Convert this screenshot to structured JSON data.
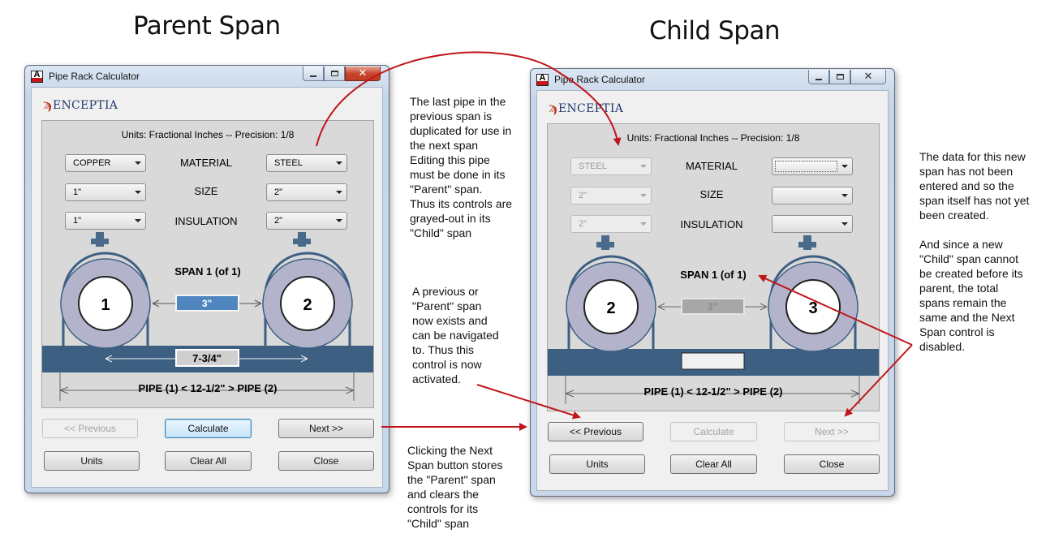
{
  "headings": {
    "parent": "Parent Span",
    "child": "Child Span"
  },
  "window_title": "Pipe Rack Calculator",
  "app_icon_letter": "A",
  "logo_text": "ENCEPTIA",
  "units_line": "Units: Fractional Inches -- Precision: 1/8",
  "labels": {
    "material": "MATERIAL",
    "size": "SIZE",
    "insulation": "INSULATION"
  },
  "buttons": {
    "previous": "<< Previous",
    "calculate": "Calculate",
    "next": "Next >>",
    "units": "Units",
    "clear_all": "Clear All",
    "close": "Close"
  },
  "parent": {
    "left": {
      "material": "COPPER",
      "size": "1\"",
      "insulation": "1\""
    },
    "right": {
      "material": "STEEL",
      "size": "2\"",
      "insulation": "2\""
    },
    "span_title": "SPAN 1 (of 1)",
    "pipe_numbers": [
      "1",
      "2"
    ],
    "gap_value": "3\"",
    "between_value": "7-3/4\"",
    "pipe_label": "PIPE (1) <  12-1/2\"  > PIPE (2)",
    "previous_enabled": false,
    "calculate_enabled": true,
    "next_enabled": true
  },
  "child": {
    "left": {
      "material": "STEEL",
      "size": "2\"",
      "insulation": "2\""
    },
    "right": {
      "material": "",
      "size": "",
      "insulation": ""
    },
    "span_title": "SPAN 1 (of 1)",
    "pipe_numbers": [
      "2",
      "3"
    ],
    "gap_value": "3\"",
    "between_value": "",
    "pipe_label": "PIPE (1) <  12-1/2\"  > PIPE (2)",
    "previous_enabled": true,
    "calculate_enabled": false,
    "next_enabled": false
  },
  "notes": {
    "duplicate": [
      "The last pipe in the",
      "previous span is",
      "duplicated for use in",
      "the next span",
      "Editing this pipe",
      "must be done in its",
      "\"Parent\" span.",
      "Thus its controls are",
      "grayed-out in its",
      "\"Child\" span"
    ],
    "previous": [
      "A previous or",
      "\"Parent\" span",
      "now exists and",
      "can be navigated",
      "to. Thus this",
      "control is now",
      "activated."
    ],
    "next_click": [
      "Clicking the Next",
      "Span button stores",
      "the \"Parent\" span",
      "and clears the",
      "controls for its",
      "\"Child\" span"
    ],
    "not_entered": [
      "The data for this new",
      "span has not been",
      "entered and so the",
      "span itself has not yet",
      "been created."
    ],
    "since": [
      "And since a new",
      "\"Child\" span cannot",
      "be created before its",
      "parent,  the total",
      "spans remain the",
      "same and the Next",
      "Span control is",
      "disabled."
    ]
  },
  "colors": {
    "arrow": "#c0151b",
    "beam": "#3d5f82",
    "pipe_ring": "#b3b4cc",
    "value_box": "#4f86c0"
  }
}
